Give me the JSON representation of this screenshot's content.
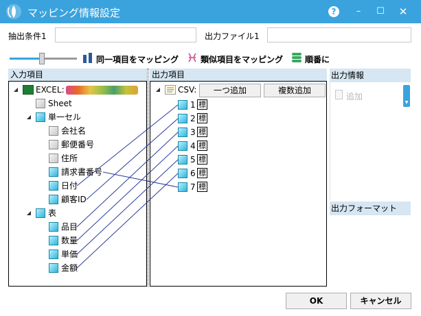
{
  "window": {
    "title": "マッピング情報設定",
    "help_glyph": "?",
    "minimize_glyph": "–",
    "maximize_glyph": "☐",
    "close_glyph": "✕"
  },
  "filter": {
    "extract_label": "抽出条件1",
    "extract_value": "",
    "output_file_label": "出力ファイル1",
    "output_file_value": ""
  },
  "mapping_options": {
    "slider_level": 0.5,
    "same_item_label": "同一項目をマッピング",
    "similar_item_label": "類似項目をマッピング",
    "sequential_label": "順番に",
    "same_item_icon": "parallel-bars-icon",
    "similar_item_icon": "pink-link-icon",
    "sequential_icon": "stacked-green-icon"
  },
  "input_pane": {
    "header": "入力項目",
    "root": {
      "label": "EXCEL:",
      "icon": "excel-icon",
      "expander": "◢"
    },
    "sheet": "Sheet",
    "single_cell": {
      "label": "単一セル",
      "expander": "◢"
    },
    "single_cell_items": [
      "会社名",
      "郵便番号",
      "住所",
      "請求書番号",
      "日付",
      "顧客ID"
    ],
    "table": {
      "label": "表",
      "expander": "◢"
    },
    "table_items": [
      "品目",
      "数量",
      "単価",
      "金額"
    ]
  },
  "output_pane": {
    "header": "出力項目",
    "root": {
      "label": "CSV:",
      "icon": "csv-icon",
      "expander": "◢"
    },
    "add_one_button": "一つ追加",
    "add_multiple_button": "複数追加",
    "items": [
      "1",
      "2",
      "3",
      "4",
      "5",
      "6",
      "7"
    ],
    "marker": "標"
  },
  "info_pane": {
    "header": "出力情報",
    "add_label": "追加",
    "format_header": "出力フォーマット"
  },
  "buttons": {
    "ok": "OK",
    "cancel": "キャンセル"
  },
  "colors": {
    "titlebar": "#3aa3dd",
    "header_bg": "#d6e6f2",
    "link_line": "#2a3a9a"
  }
}
